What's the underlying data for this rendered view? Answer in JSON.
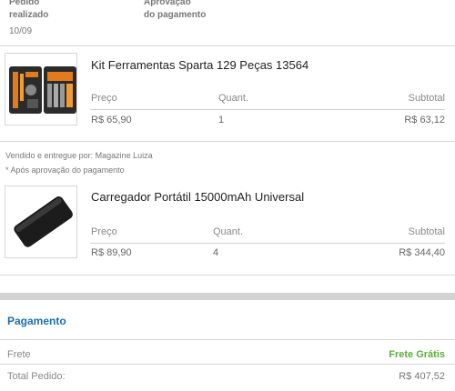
{
  "steps": {
    "ordered": {
      "line1": "Pedido",
      "line2": "realizado",
      "date": "10/09"
    },
    "approval": {
      "line1": "Aprovação",
      "line2": "do pagamento"
    }
  },
  "columns": {
    "price": "Preço",
    "qty": "Quant.",
    "subtotal": "Subtotal"
  },
  "items": [
    {
      "name": "Kit Ferramentas Sparta 129 Peças 13564",
      "price": "R$ 65,90",
      "qty": "1",
      "subtotal": "R$ 63,12",
      "image_icon": "toolkit-case-image"
    },
    {
      "name": "Carregador Portátil 15000mAh Universal",
      "price": "R$ 89,90",
      "qty": "4",
      "subtotal": "R$ 344,40",
      "image_icon": "power-bank-image"
    }
  ],
  "seller": {
    "line1": "Vendido e entregue por: Magazine Luiza",
    "line2": "* Após aprovação do pagamento"
  },
  "payment": {
    "title": "Pagamento",
    "shipping_label": "Frete",
    "shipping_value": "Frete Grátis",
    "total_label": "Total Pedido:",
    "total_value": "R$ 407,52"
  },
  "colors": {
    "accent": "#1a6fae",
    "free_shipping": "#5cae3a"
  }
}
